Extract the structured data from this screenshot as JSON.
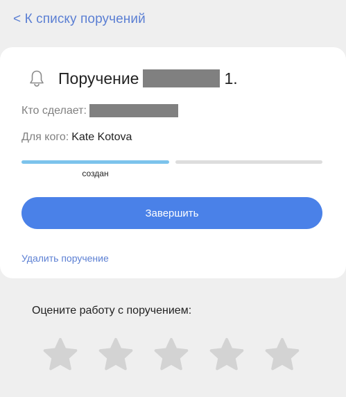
{
  "back_link": {
    "label": "< К списку поручений"
  },
  "task": {
    "title_prefix": "Поручение",
    "title_suffix": "1.",
    "assignee_label": "Кто сделает:",
    "recipient_label": "Для кого:",
    "recipient_value": "Kate Kotova",
    "status_label": "создан",
    "progress_fraction": 0.5
  },
  "actions": {
    "complete_label": "Завершить",
    "delete_label": "Удалить поручение"
  },
  "rating": {
    "title": "Оцените работу с поручением:",
    "max_stars": 5,
    "value": 0
  },
  "icons": {
    "bell": "bell-icon",
    "star": "star-icon"
  },
  "colors": {
    "accent": "#4a81e8",
    "link": "#5b7fd3",
    "progress_done": "#7cc3ec",
    "progress_todo": "#dddddd",
    "star_inactive": "#d3d3d3",
    "redacted": "#808080"
  }
}
